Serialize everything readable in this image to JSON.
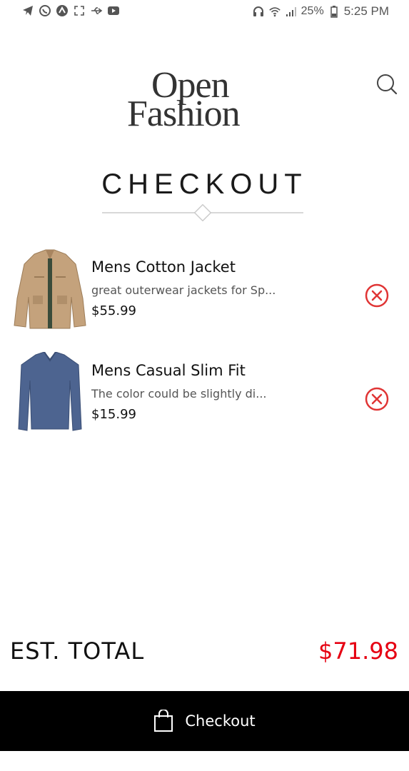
{
  "status_bar": {
    "battery": "25%",
    "time": "5:25 PM",
    "left_icons": [
      "telegram-icon",
      "whatsapp-icon",
      "app-icon",
      "expand-icon",
      "usb-icon",
      "youtube-icon"
    ],
    "right_icons": [
      "headset-icon",
      "wifi-icon",
      "signal-icon",
      "battery-icon"
    ]
  },
  "header": {
    "logo_line1": "Open",
    "logo_line2": "Fashion",
    "search_icon": "search-icon"
  },
  "page": {
    "title": "CHECKOUT"
  },
  "cart": {
    "items": [
      {
        "name": "Mens Cotton Jacket",
        "description": "great outerwear jackets for Sp...",
        "price": "$55.99",
        "image": "jacket-thumbnail",
        "remove_icon": "remove-circle-x-icon"
      },
      {
        "name": "Mens Casual Slim Fit",
        "description": "The color could be slightly di...",
        "price": "$15.99",
        "image": "shirt-thumbnail",
        "remove_icon": "remove-circle-x-icon"
      }
    ]
  },
  "summary": {
    "total_label": "EST. TOTAL",
    "total_value": "$71.98"
  },
  "checkout_button": {
    "label": "Checkout",
    "icon": "shopping-bag-icon"
  },
  "colors": {
    "accent_red": "#e60012",
    "button_bg": "#000000",
    "remove_icon": "#e03535"
  }
}
